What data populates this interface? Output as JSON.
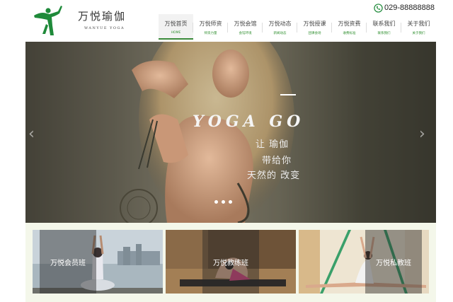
{
  "brand": {
    "name": "万悦瑜伽",
    "subtitle": "WANYUE YOGA",
    "logo_icon": "yoga-pose-icon",
    "accent": "#1f8a3a"
  },
  "contact": {
    "phone_icon": "phone-icon",
    "phone": "029-88888888"
  },
  "nav": {
    "items": [
      {
        "label": "万悦首页",
        "sub": "HOME"
      },
      {
        "label": "万悦师资",
        "sub": "师资力量"
      },
      {
        "label": "万悦会馆",
        "sub": "会馆环境"
      },
      {
        "label": "万悦动态",
        "sub": "新闻动态"
      },
      {
        "label": "万悦授课",
        "sub": "团课会场"
      },
      {
        "label": "万悦资费",
        "sub": "收费标准"
      },
      {
        "label": "联系我们",
        "sub": "联系我们"
      },
      {
        "label": "关于我们",
        "sub": "关于我们"
      }
    ],
    "active_index": 0
  },
  "banner": {
    "title": "YOGA GO",
    "lines": [
      "让 瑜伽",
      "带给你",
      "天然的 改变"
    ],
    "prev_icon": "chevron-left-icon",
    "next_icon": "chevron-right-icon",
    "slide_count": 3
  },
  "classes": [
    {
      "label": "万悦会员班"
    },
    {
      "label": "万悦教练班"
    },
    {
      "label": "万悦私教班"
    }
  ]
}
